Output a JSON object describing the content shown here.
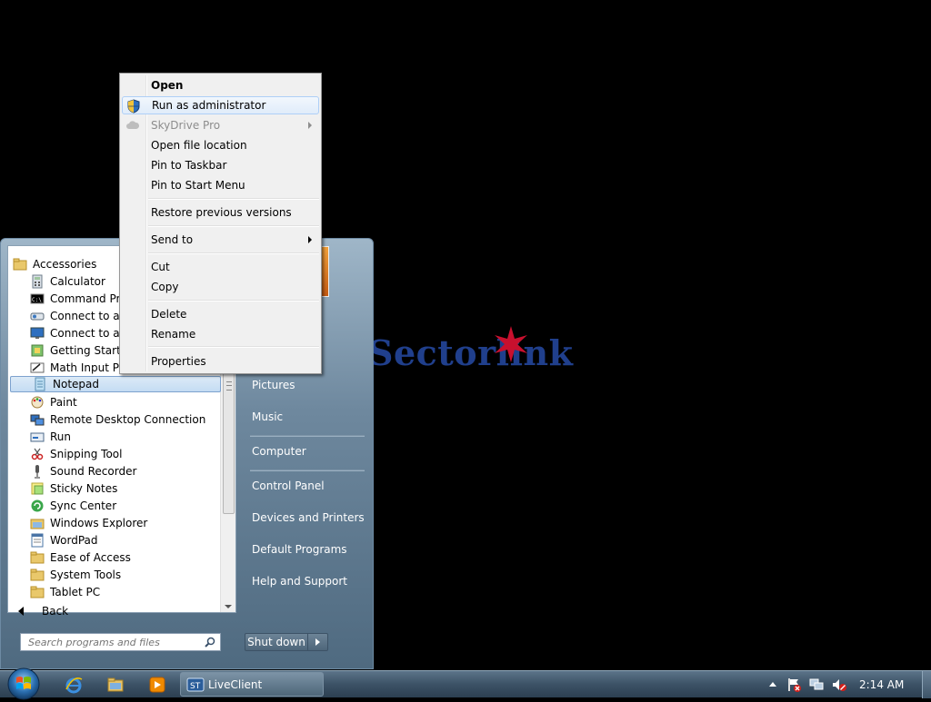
{
  "desktop": {
    "logo_text": "Sectorlink"
  },
  "start_menu": {
    "programs": [
      {
        "label": "Accessories",
        "icon": "folder-icon",
        "level": "root"
      },
      {
        "label": "Calculator",
        "icon": "calculator-icon",
        "level": "sub"
      },
      {
        "label": "Command Prompt",
        "icon": "command-prompt-icon",
        "level": "sub"
      },
      {
        "label": "Connect to a Network Projector",
        "icon": "projector-icon",
        "level": "sub"
      },
      {
        "label": "Connect to a Projector",
        "icon": "monitor-icon",
        "level": "sub"
      },
      {
        "label": "Getting Started",
        "icon": "getting-started-icon",
        "level": "sub"
      },
      {
        "label": "Math Input Panel",
        "icon": "math-input-icon",
        "level": "sub"
      },
      {
        "label": "Notepad",
        "icon": "notepad-icon",
        "level": "sub",
        "selected": true
      },
      {
        "label": "Paint",
        "icon": "paint-icon",
        "level": "sub"
      },
      {
        "label": "Remote Desktop Connection",
        "icon": "remote-desktop-icon",
        "level": "sub"
      },
      {
        "label": "Run",
        "icon": "run-icon",
        "level": "sub"
      },
      {
        "label": "Snipping Tool",
        "icon": "scissors-icon",
        "level": "sub"
      },
      {
        "label": "Sound Recorder",
        "icon": "microphone-icon",
        "level": "sub"
      },
      {
        "label": "Sticky Notes",
        "icon": "sticky-notes-icon",
        "level": "sub"
      },
      {
        "label": "Sync Center",
        "icon": "sync-icon",
        "level": "sub"
      },
      {
        "label": "Windows Explorer",
        "icon": "explorer-icon",
        "level": "sub"
      },
      {
        "label": "WordPad",
        "icon": "wordpad-icon",
        "level": "sub"
      },
      {
        "label": "Ease of Access",
        "icon": "folder-icon",
        "level": "sub"
      },
      {
        "label": "System Tools",
        "icon": "folder-icon",
        "level": "sub"
      },
      {
        "label": "Tablet PC",
        "icon": "folder-icon",
        "level": "sub"
      }
    ],
    "back_label": "Back",
    "search_placeholder": "Search programs and files",
    "right_items": [
      {
        "label": "Pictures"
      },
      {
        "label": "Music"
      },
      {
        "label": "Computer"
      },
      {
        "label": "Control Panel"
      },
      {
        "label": "Devices and Printers"
      },
      {
        "label": "Default Programs"
      },
      {
        "label": "Help and Support"
      }
    ],
    "shutdown_label": "Shut down"
  },
  "context_menu": {
    "items": [
      {
        "label": "Open",
        "bold": true
      },
      {
        "label": "Run as administrator",
        "icon": "uac-shield-icon",
        "hover": true
      },
      {
        "label": "SkyDrive Pro",
        "icon": "cloud-icon",
        "disabled": true,
        "submenu": true
      },
      {
        "label": "Open file location"
      },
      {
        "label": "Pin to Taskbar"
      },
      {
        "label": "Pin to Start Menu"
      },
      {
        "label": "Restore previous versions"
      },
      {
        "label": "Send to",
        "submenu": true
      },
      {
        "label": "Cut"
      },
      {
        "label": "Copy"
      },
      {
        "label": "Delete"
      },
      {
        "label": "Rename"
      },
      {
        "label": "Properties"
      }
    ]
  },
  "taskbar": {
    "task_label": "LiveClient",
    "clock": "2:14 AM"
  },
  "colors": {
    "logo": "#203f8c",
    "logo_star": "#c8102e",
    "menu_hover_border": "#aecff7",
    "taskbar": "#3c5266"
  }
}
